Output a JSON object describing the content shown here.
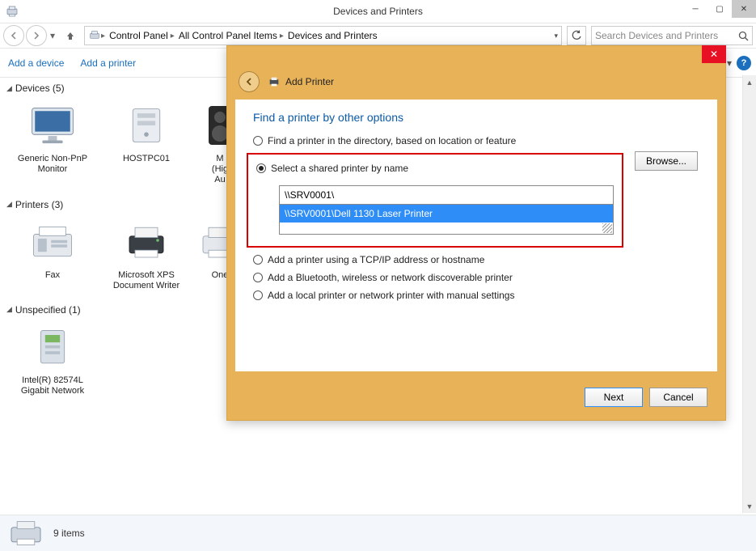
{
  "window": {
    "title": "Devices and Printers",
    "search_placeholder": "Search Devices and Printers"
  },
  "breadcrumb": [
    "Control Panel",
    "All Control Panel Items",
    "Devices and Printers"
  ],
  "commands": {
    "add_device": "Add a device",
    "add_printer": "Add a printer"
  },
  "sections": {
    "devices": {
      "title": "Devices (5)"
    },
    "printers": {
      "title": "Printers (3)"
    },
    "unspecified": {
      "title": "Unspecified (1)"
    }
  },
  "devices": [
    {
      "label": "Generic Non-PnP Monitor"
    },
    {
      "label": "HOSTPC01"
    },
    {
      "label": "M\n(Hig\nAu"
    }
  ],
  "printers": [
    {
      "label": "Fax"
    },
    {
      "label": "Microsoft XPS Document Writer"
    },
    {
      "label": "One"
    }
  ],
  "unspecified": [
    {
      "label": "Intel(R) 82574L Gigabit Network"
    }
  ],
  "statusbar": {
    "count": "9 items"
  },
  "dialog": {
    "title": "Add Printer",
    "heading": "Find a printer by other options",
    "options": {
      "directory": "Find a printer in the directory, based on location or feature",
      "shared": "Select a shared printer by name",
      "tcpip": "Add a printer using a TCP/IP address or hostname",
      "bluetooth": "Add a Bluetooth, wireless or network discoverable printer",
      "local": "Add a local printer or network printer with manual settings"
    },
    "input_value": "\\\\SRV0001\\",
    "dropdown_item": "\\\\SRV0001\\Dell 1130 Laser Printer",
    "browse": "Browse...",
    "next": "Next",
    "cancel": "Cancel"
  }
}
